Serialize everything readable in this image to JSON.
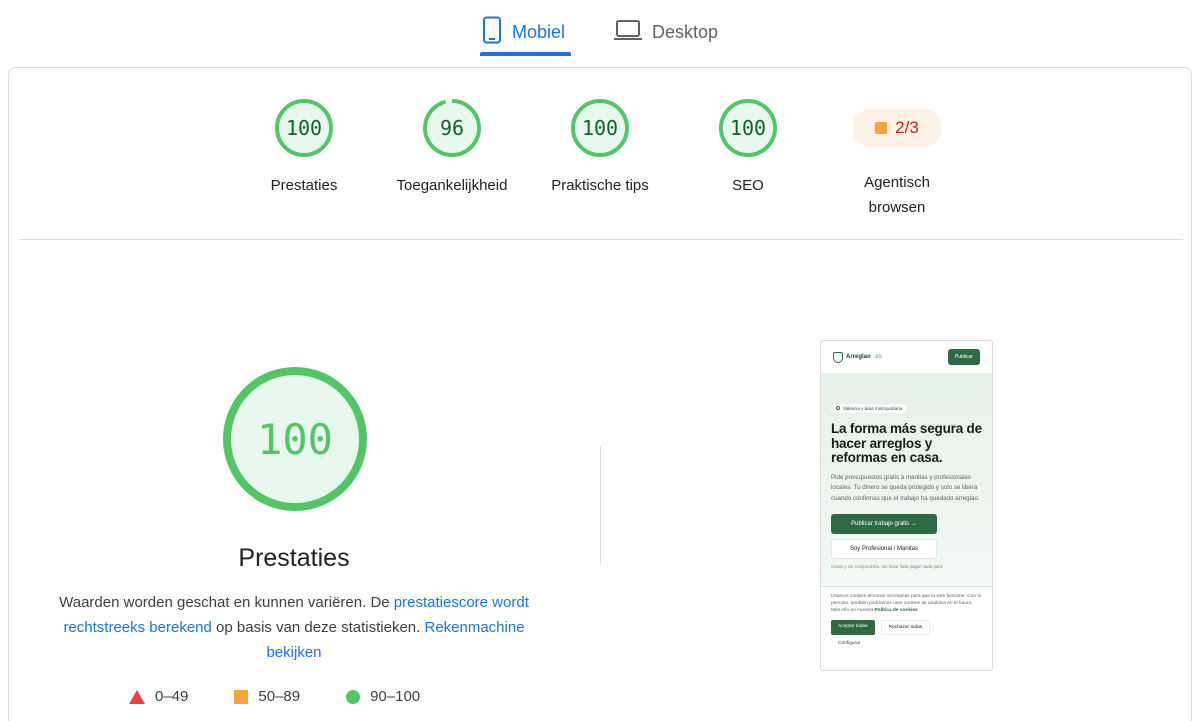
{
  "tabs": [
    {
      "label": "Mobiel",
      "icon": "smartphone-icon",
      "active": true
    },
    {
      "label": "Desktop",
      "icon": "laptop-icon",
      "active": false
    }
  ],
  "colors": {
    "accent": "#1a73e8",
    "pass": "#0cce6b",
    "pass_ring": "#52c667",
    "pass_bg": "#e9f8ee",
    "average": "#fba33a",
    "fail": "#e8453c"
  },
  "categories": [
    {
      "score": "100",
      "value": 100,
      "label": "Prestaties"
    },
    {
      "score": "96",
      "value": 96,
      "label": "Toegankelijkheid"
    },
    {
      "score": "100",
      "value": 100,
      "label": "Praktische tips"
    },
    {
      "score": "100",
      "value": 100,
      "label": "SEO"
    }
  ],
  "agentic": {
    "score": "2/3",
    "label": "Agentisch browsen",
    "status": "average"
  },
  "performance": {
    "score": "100",
    "value": 100,
    "title": "Prestaties",
    "desc_1": "Waarden worden geschat en kunnen variëren. De ",
    "link_1": "prestatiescore wordt rechtstreeks berekend",
    "desc_2": " op basis van deze statistieken. ",
    "link_2": "Rekenmachine bekijken"
  },
  "legend": [
    {
      "shape": "triangle",
      "range": "0–49"
    },
    {
      "shape": "square",
      "range": "50–89"
    },
    {
      "shape": "circle",
      "range": "90–100"
    }
  ],
  "screenshot": {
    "logo": "Arreglao",
    "logo_suffix": ".es",
    "publicar": "Publicar",
    "chip": "Valencia y área metropolitana",
    "headline": "La forma más segura de hacer arreglos y reformas en casa.",
    "paragraph": "Pide presupuestos gratis a manitas y profesionales locales. Tu dinero se queda protegido y solo se libera cuando confirmas que el trabajo ha quedado arreglao.",
    "btn_primary": "Publicar trabajo gratis →",
    "btn_secondary": "Soy Profesional / Manitas",
    "small": "Gratis y sin compromiso. No hace falta pagar nada para",
    "cookie_text": "Usamos cookies técnicas necesarias para que la web funcione. Con tu permiso, también podríamos usar cookies de analítica en el futuro. Más info en nuestra ",
    "cookie_link": "Política de cookies",
    "cookie_end": ".",
    "accept": "Aceptar todas",
    "reject": "Rechazar todas",
    "configure": "Configurar"
  }
}
